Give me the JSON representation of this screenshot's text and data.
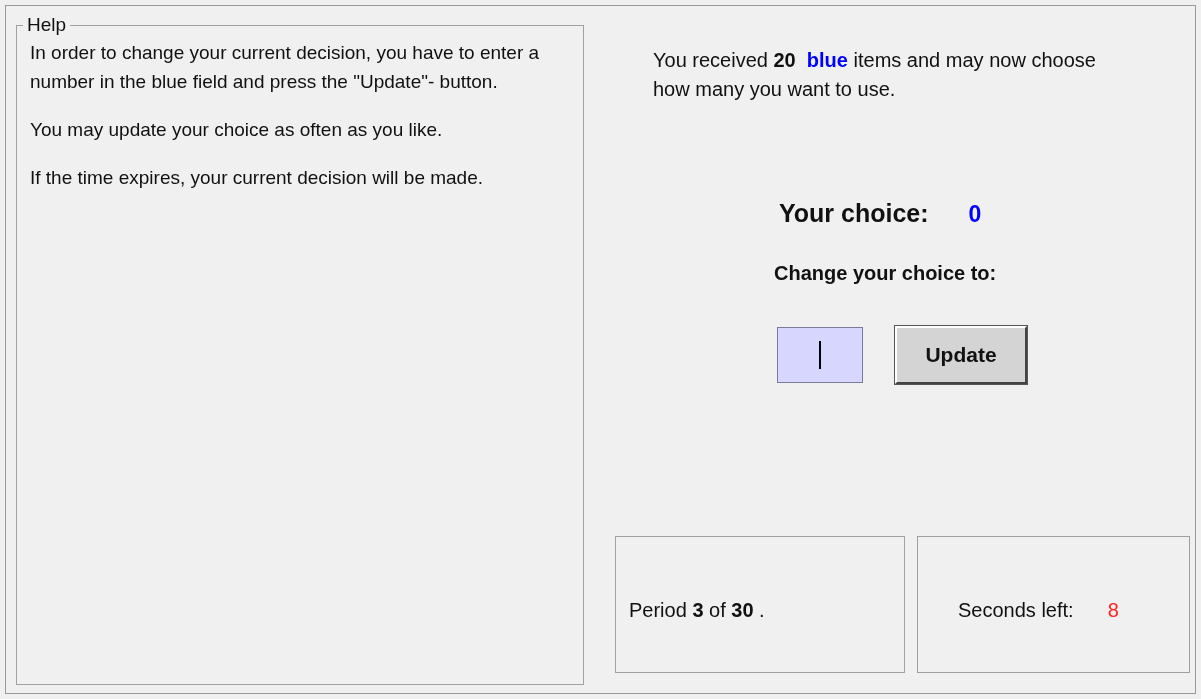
{
  "help": {
    "title": "Help",
    "paragraphs": [
      "In order to change your current decision, you have to enter a number in the blue field and press the \"Update\"- button.",
      "You may update your choice as often as you like.",
      "If the time expires, your current decision will be made."
    ]
  },
  "message": {
    "before": "You received",
    "amount": "20",
    "color_word": "blue",
    "after": "items and may now choose how many you want to use."
  },
  "choice": {
    "label": "Your choice:",
    "value": "0"
  },
  "change": {
    "label": "Change your choice to:",
    "focused": true,
    "button": "Update"
  },
  "period": {
    "text": "Period **3**  of **30** ."
  },
  "seconds": {
    "label": "Seconds left:",
    "value": "8"
  }
}
